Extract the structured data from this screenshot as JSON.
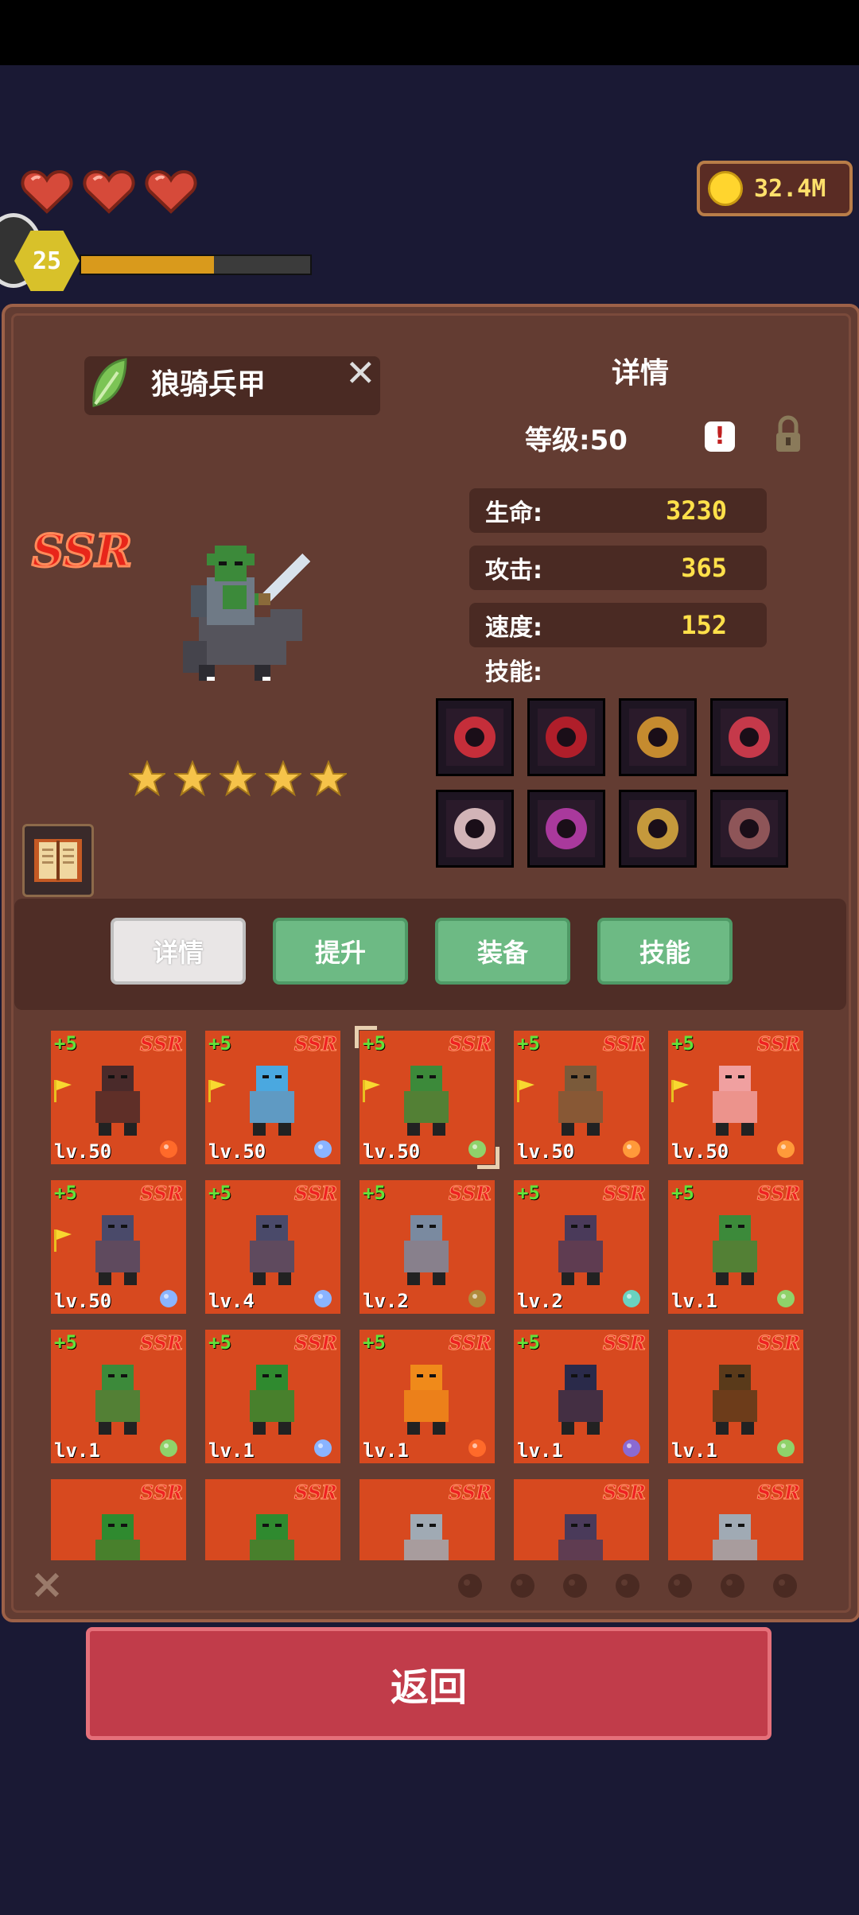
{
  "hud": {
    "hearts": 3,
    "player_level": "25",
    "xp_progress": 0.58,
    "coins": "32.4M"
  },
  "hero": {
    "name": "狼骑兵甲",
    "rarity": "SSR",
    "stars": 5,
    "element_icon": "leaf-icon"
  },
  "detail": {
    "title": "详情",
    "level": "等级:50",
    "alert": "!",
    "stats": [
      {
        "label": "生命:",
        "value": "3230"
      },
      {
        "label": "攻击:",
        "value": "365"
      },
      {
        "label": "速度:",
        "value": "152"
      }
    ],
    "skills_label": "技能:",
    "skills": [
      {
        "icon": "fist-icon",
        "color": "#e0333d"
      },
      {
        "icon": "demon-face-icon",
        "color": "#c8202a"
      },
      {
        "icon": "fanged-mouth-icon",
        "color": "#e0a030"
      },
      {
        "icon": "red-sword-icon",
        "color": "#e04050"
      },
      {
        "icon": "blood-pillar-icon",
        "color": "#f0d0d0"
      },
      {
        "icon": "vortex-icon",
        "color": "#c040b0"
      },
      {
        "icon": "sword-strike-icon",
        "color": "#e0b040"
      },
      {
        "icon": "shield-bell-icon",
        "color": "#a06060"
      }
    ]
  },
  "tabs": [
    {
      "label": "详情",
      "active": true
    },
    {
      "label": "提升",
      "active": false
    },
    {
      "label": "装备",
      "active": false
    },
    {
      "label": "技能",
      "active": false
    }
  ],
  "roster": [
    {
      "plus": "+5",
      "rarity": "SSR",
      "level": "lv.50",
      "flag": true,
      "element": "fire",
      "sprite": "dark-knight",
      "selected": false
    },
    {
      "plus": "+5",
      "rarity": "SSR",
      "level": "lv.50",
      "flag": true,
      "element": "water",
      "sprite": "water-elemental",
      "selected": false
    },
    {
      "plus": "+5",
      "rarity": "SSR",
      "level": "lv.50",
      "flag": true,
      "element": "leaf",
      "sprite": "wolf-rider",
      "selected": true
    },
    {
      "plus": "+5",
      "rarity": "SSR",
      "level": "lv.50",
      "flag": true,
      "element": "sun",
      "sprite": "deer-druid",
      "selected": false
    },
    {
      "plus": "+5",
      "rarity": "SSR",
      "level": "lv.50",
      "flag": true,
      "element": "sun",
      "sprite": "fairy",
      "selected": false
    },
    {
      "plus": "+5",
      "rarity": "SSR",
      "level": "lv.50",
      "flag": true,
      "element": "water",
      "sprite": "shadow-rider",
      "selected": false
    },
    {
      "plus": "+5",
      "rarity": "SSR",
      "level": "lv.4",
      "flag": false,
      "element": "water",
      "sprite": "shadow-rider",
      "selected": false
    },
    {
      "plus": "+5",
      "rarity": "SSR",
      "level": "lv.2",
      "flag": false,
      "element": "earth",
      "sprite": "stone-golem",
      "selected": false
    },
    {
      "plus": "+5",
      "rarity": "SSR",
      "level": "lv.2",
      "flag": false,
      "element": "wind",
      "sprite": "hooded-bird",
      "selected": false
    },
    {
      "plus": "+5",
      "rarity": "SSR",
      "level": "lv.1",
      "flag": false,
      "element": "leaf",
      "sprite": "wolf-rider",
      "selected": false
    },
    {
      "plus": "+5",
      "rarity": "SSR",
      "level": "lv.1",
      "flag": false,
      "element": "leaf",
      "sprite": "wolf-rider",
      "selected": false
    },
    {
      "plus": "+5",
      "rarity": "SSR",
      "level": "lv.1",
      "flag": false,
      "element": "water",
      "sprite": "green-ogre",
      "selected": false
    },
    {
      "plus": "+5",
      "rarity": "SSR",
      "level": "lv.1",
      "flag": false,
      "element": "fire",
      "sprite": "fire-spirit",
      "selected": false
    },
    {
      "plus": "+5",
      "rarity": "SSR",
      "level": "lv.1",
      "flag": false,
      "element": "moon",
      "sprite": "armored-knight",
      "selected": false
    },
    {
      "plus": "",
      "rarity": "SSR",
      "level": "lv.1",
      "flag": false,
      "element": "leaf",
      "sprite": "treant",
      "selected": false
    },
    {
      "plus": "",
      "rarity": "SSR",
      "level": "",
      "flag": false,
      "element": "",
      "sprite": "green-ogre",
      "selected": false
    },
    {
      "plus": "",
      "rarity": "SSR",
      "level": "",
      "flag": false,
      "element": "",
      "sprite": "green-ogre",
      "selected": false
    },
    {
      "plus": "",
      "rarity": "SSR",
      "level": "",
      "flag": false,
      "element": "",
      "sprite": "grey-wolf",
      "selected": false
    },
    {
      "plus": "",
      "rarity": "SSR",
      "level": "",
      "flag": false,
      "element": "",
      "sprite": "hooded-bird",
      "selected": false
    },
    {
      "plus": "",
      "rarity": "SSR",
      "level": "",
      "flag": false,
      "element": "",
      "sprite": "grey-wolf",
      "selected": false
    }
  ],
  "filters": [
    "close-icon",
    "leaf-icon",
    "earth-icon",
    "water-icon",
    "wind-icon",
    "fire-icon",
    "sun-icon",
    "moon-icon"
  ],
  "back_label": "返回",
  "colors": {
    "card_bg": "#d7491f",
    "panel_bg": "#633c32",
    "tab_green": "#6dba84",
    "back_button": "#c13c4a",
    "stat_value": "#ffe04a"
  }
}
